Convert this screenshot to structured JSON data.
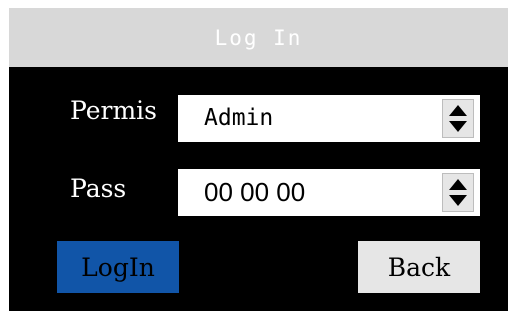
{
  "window": {
    "title": "Log In"
  },
  "form": {
    "permission": {
      "label": "Permis",
      "value": "Admin"
    },
    "password": {
      "label": "Pass",
      "value": "00 00 00"
    }
  },
  "buttons": {
    "login_label": "LogIn",
    "back_label": "Back"
  },
  "colors": {
    "titlebar": "#d8d8d8",
    "screen": "#000000",
    "login_button": "#1155a8",
    "back_button": "#e6e6e6"
  },
  "icons": {
    "stepper": "up-down-arrows-icon"
  }
}
